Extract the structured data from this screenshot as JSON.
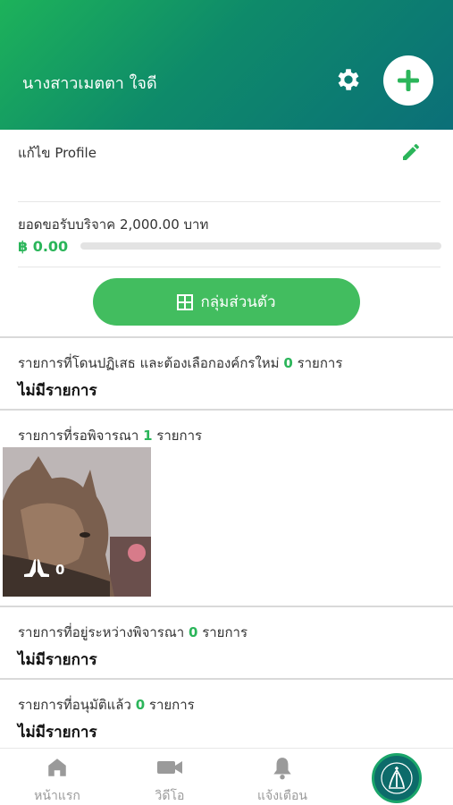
{
  "header": {
    "user_name": "นางสาวเมตตา ใจดี",
    "settings_icon": "gear-icon",
    "add_icon": "plus-icon",
    "accent": "#1db25a"
  },
  "profile": {
    "edit_label": "แก้ไข Profile",
    "edit_icon": "pencil-icon"
  },
  "donation": {
    "target_label": "ยอดขอรับบริจาค 2,000.00 บาท",
    "current_value": "฿ 0.00",
    "progress_fraction": 0
  },
  "group_button": {
    "label": "กลุ่มส่วนตัว",
    "icon": "grid-icon"
  },
  "sections": {
    "rejected": {
      "title_prefix": "รายการที่โดนปฏิเสธ และต้องเลือกองค์กรใหม่",
      "count": "0",
      "title_suffix": "รายการ",
      "empty_text": "ไม่มีรายการ"
    },
    "pending": {
      "title_prefix": "รายการที่รอพิจารณา",
      "count": "1",
      "title_suffix": "รายการ",
      "item_pray_count": "0"
    },
    "in_review": {
      "title_prefix": "รายการที่อยู่ระหว่างพิจารณา",
      "count": "0",
      "title_suffix": "รายการ",
      "empty_text": "ไม่มีรายการ"
    },
    "approved": {
      "title_prefix": "รายการที่อนุมัติแล้ว",
      "count": "0",
      "title_suffix": "รายการ",
      "empty_text": "ไม่มีรายการ"
    }
  },
  "bottom_nav": {
    "home": "หน้าแรก",
    "video": "วิดีโอ",
    "notifications": "แจ้งเตือน"
  }
}
